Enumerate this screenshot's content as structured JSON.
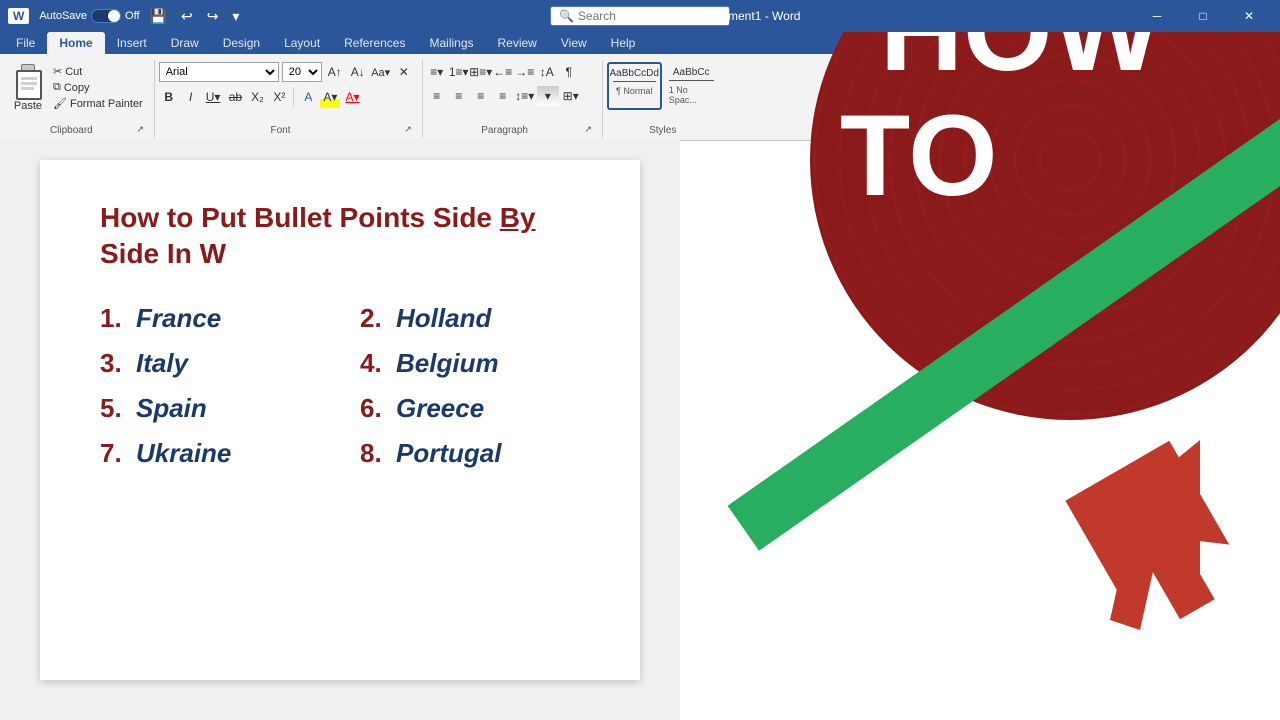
{
  "titlebar": {
    "autosave_label": "AutoSave",
    "autosave_state": "Off",
    "doc_name": "Document1 - Word",
    "search_placeholder": "Search",
    "window_title": "Document1 - Word"
  },
  "menu": {
    "items": [
      "File",
      "Home",
      "Insert",
      "Draw",
      "Design",
      "Layout",
      "References",
      "Mailings",
      "Review",
      "View",
      "Help"
    ]
  },
  "ribbon": {
    "active_tab": "Home",
    "clipboard": {
      "label": "Clipboard",
      "paste_label": "Paste",
      "cut_label": "Cut",
      "copy_label": "Copy",
      "format_painter_label": "Format Painter"
    },
    "font": {
      "label": "Font",
      "font_name": "Arial",
      "font_size": "20",
      "bold": "B",
      "italic": "I",
      "underline": "U",
      "strikethrough": "S",
      "subscript": "X₂",
      "superscript": "X²",
      "font_color_label": "A",
      "highlight_label": "A",
      "clear_format": "✕"
    },
    "paragraph": {
      "label": "Paragraph"
    },
    "styles": {
      "label": "Styles",
      "items": [
        {
          "name": "Normal",
          "preview": "AaBbCcDd"
        },
        {
          "name": "No Spac...",
          "preview": "AaBbCc"
        }
      ]
    }
  },
  "document": {
    "title": "How to Put Bullet Points Side By Side In ",
    "title_underline_word": "By",
    "list_left": [
      {
        "num": "1.",
        "text": "France"
      },
      {
        "num": "3.",
        "text": "Italy"
      },
      {
        "num": "5.",
        "text": "Spain"
      },
      {
        "num": "7.",
        "text": "Ukraine"
      }
    ],
    "list_right": [
      {
        "num": "2.",
        "text": "Holland"
      },
      {
        "num": "4.",
        "text": "Belgium"
      },
      {
        "num": "6.",
        "text": "Greece"
      },
      {
        "num": "8.",
        "text": "Portugal"
      }
    ]
  },
  "overlay": {
    "how_to_line1": "HOW",
    "how_to_line2": "TO"
  },
  "colors": {
    "title_red": "#8b1a1a",
    "list_num_red": "#8b1a1a",
    "list_text_blue": "#1a3a6b",
    "word_blue": "#2b579a",
    "green_stripe": "#27ae60"
  }
}
